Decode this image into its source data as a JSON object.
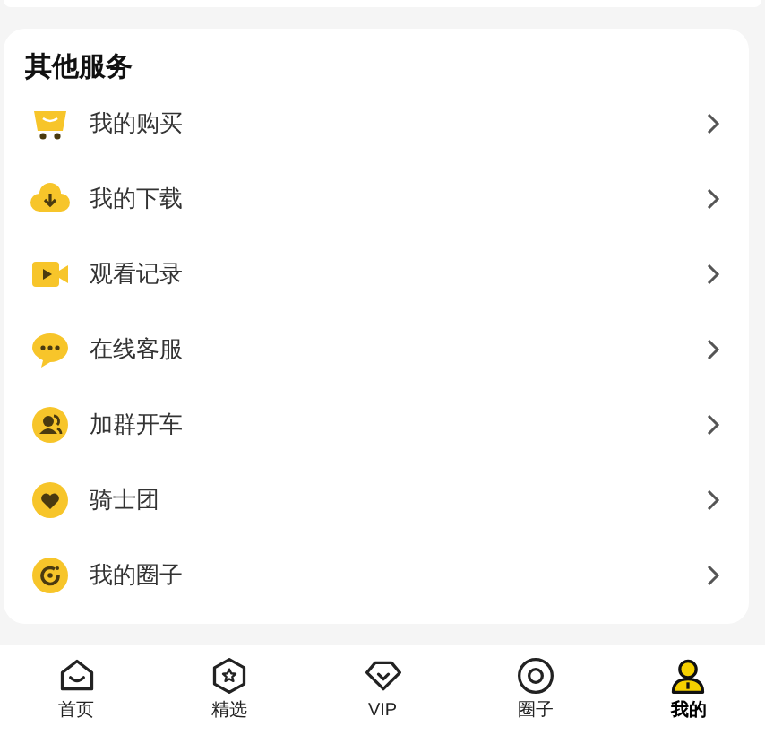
{
  "section": {
    "title": "其他服务",
    "items": [
      {
        "label": "我的购买"
      },
      {
        "label": "我的下载"
      },
      {
        "label": "观看记录"
      },
      {
        "label": "在线客服"
      },
      {
        "label": "加群开车"
      },
      {
        "label": "骑士团"
      },
      {
        "label": "我的圈子"
      }
    ]
  },
  "tab_bar": [
    {
      "label": "首页",
      "selected": false
    },
    {
      "label": "精选",
      "selected": false
    },
    {
      "label": "VIP",
      "selected": false
    },
    {
      "label": "圈子",
      "selected": false
    },
    {
      "label": "我的",
      "selected": true
    }
  ]
}
